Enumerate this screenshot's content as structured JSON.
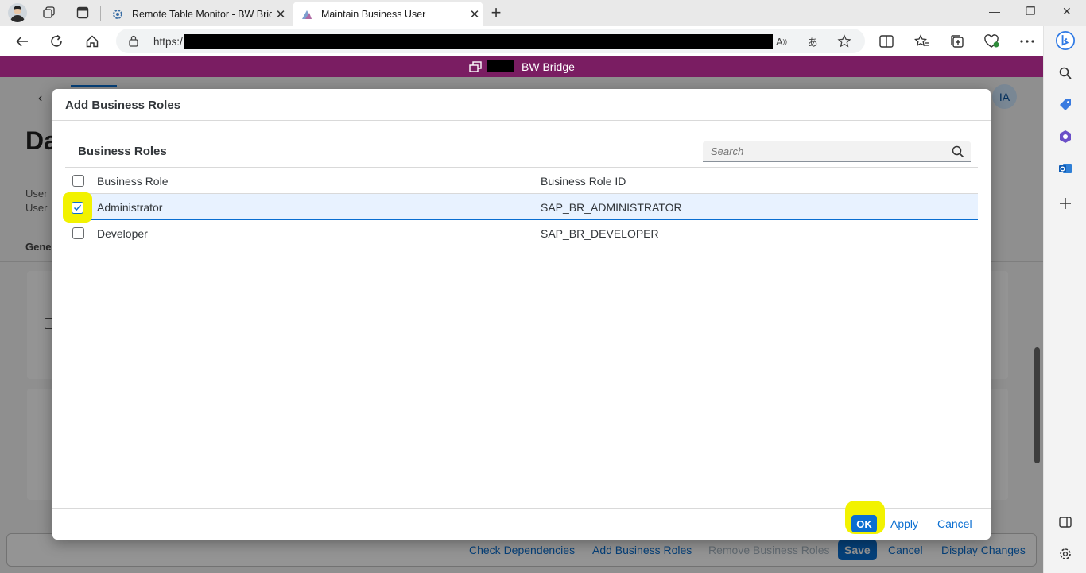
{
  "browser": {
    "tabs": [
      {
        "title": "Remote Table Monitor - BW Brid",
        "active": false
      },
      {
        "title": "Maintain Business User",
        "active": true
      }
    ],
    "url_prefix": "https:/"
  },
  "shell": {
    "title": "BW Bridge"
  },
  "background_page": {
    "title_fragment": "Da",
    "label1": "User",
    "label2": "User",
    "section_fragment": "Gene",
    "avatar_initials": "IA",
    "footer": {
      "check_dependencies": "Check Dependencies",
      "add_business_roles": "Add Business Roles",
      "remove_business_roles": "Remove Business Roles",
      "save": "Save",
      "cancel": "Cancel",
      "display_changes": "Display Changes"
    }
  },
  "dialog": {
    "title": "Add Business Roles",
    "section_title": "Business Roles",
    "search_placeholder": "Search",
    "columns": [
      "Business Role",
      "Business Role ID"
    ],
    "rows": [
      {
        "role": "Administrator",
        "id": "SAP_BR_ADMINISTRATOR",
        "selected": true
      },
      {
        "role": "Developer",
        "id": "SAP_BR_DEVELOPER",
        "selected": false
      }
    ],
    "buttons": {
      "ok": "OK",
      "apply": "Apply",
      "cancel": "Cancel"
    }
  },
  "colors": {
    "shell": "#7a1d62",
    "accent": "#0a6ed1",
    "highlight": "#f2f200"
  }
}
